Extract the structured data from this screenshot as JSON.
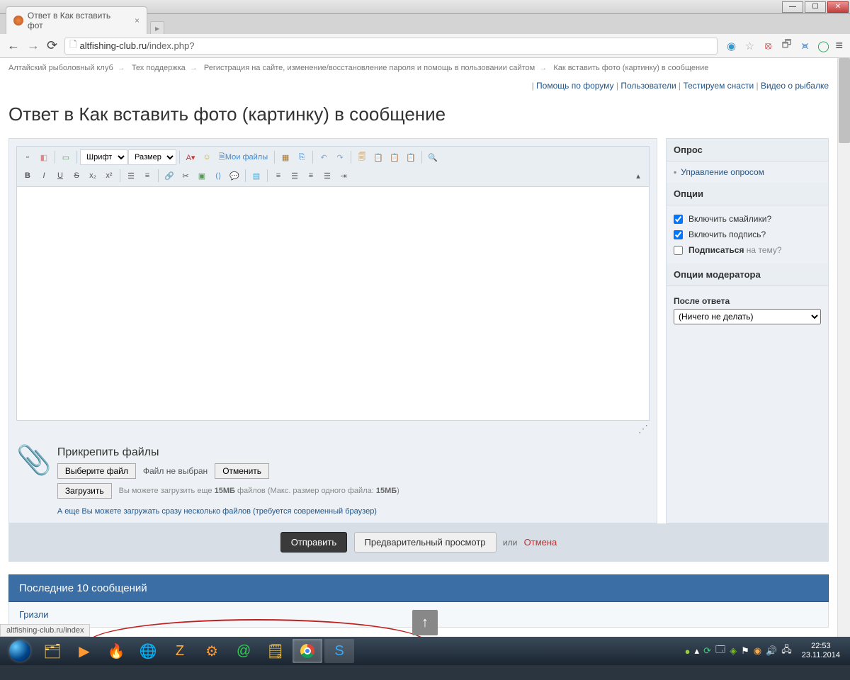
{
  "browser": {
    "tab_title": "Ответ в Как вставить фот",
    "url_prefix": "altfishing-club.ru",
    "url_suffix": "/index.php?",
    "status_bar": "altfishing-club.ru/index"
  },
  "breadcrumb": {
    "items": [
      "Алтайский рыболовный клуб",
      "Тех поддержка",
      "Регистрация на сайте, изменение/восстановление пароля и помощь в пользовании сайтом",
      "Как вставить фото (картинку) в сообщение"
    ]
  },
  "util_links": [
    "Помощь по форуму",
    "Пользователи",
    "Тестируем снасти",
    "Видео о рыбалке"
  ],
  "page_title": "Ответ в Как вставить фото (картинку) в сообщение",
  "toolbar": {
    "font_label": "Шрифт",
    "size_label": "Размер",
    "myfiles": "Мои файлы"
  },
  "attach": {
    "title": "Прикрепить файлы",
    "choose_btn": "Выберите файл",
    "no_file": "Файл не выбран",
    "cancel_btn": "Отменить",
    "upload_btn": "Загрузить",
    "info_prefix": "Вы можете загрузить еще ",
    "info_limit": "15МБ",
    "info_middle": " файлов (Макс. размер одного файла: ",
    "info_max": "15МБ",
    "info_suffix": ")",
    "multi_link": "А еще Вы можете загружать сразу несколько файлов (требуется современный браузер)"
  },
  "sidebar": {
    "poll_header": "Опрос",
    "poll_manage": "Управление опросом",
    "options_header": "Опции",
    "opt_smilies": "Включить смайлики?",
    "opt_signature": "Включить подпись?",
    "opt_subscribe": "Подписаться",
    "opt_subscribe_sub": " на тему?",
    "mod_header": "Опции модератора",
    "after_reply_label": "После ответа",
    "after_reply_value": "(Ничего не делать)"
  },
  "submit": {
    "send": "Отправить",
    "preview": "Предварительный просмотр",
    "or": "или",
    "cancel": "Отмена"
  },
  "posts": {
    "header": "Последние 10 сообщений",
    "author": "Гризли"
  },
  "taskbar": {
    "time": "22:53",
    "date": "23.11.2014"
  }
}
